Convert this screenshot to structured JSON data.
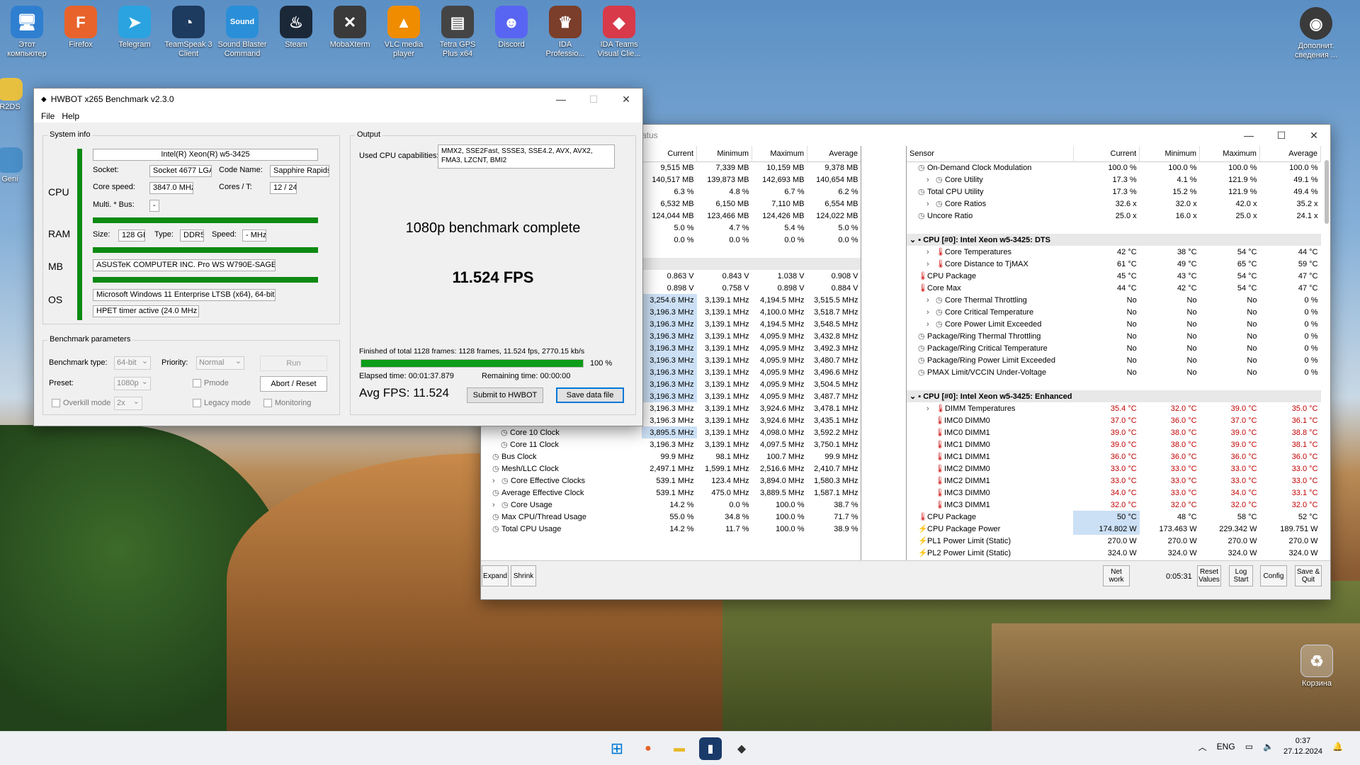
{
  "desktop": {
    "icons": [
      {
        "label": "Этот компьютер",
        "glyph": "🖥",
        "color": "#2f7fd0"
      },
      {
        "label": "Firefox",
        "glyph": "F",
        "color": "#e8632b"
      },
      {
        "label": "Telegram",
        "glyph": "➤",
        "color": "#2aa3e0"
      },
      {
        "label": "TeamSpeak 3 Client",
        "glyph": "◔",
        "color": "#1d3a5f"
      },
      {
        "label": "Sound Blaster Command",
        "glyph": "Sound",
        "color": "#2a8fd8"
      },
      {
        "label": "Steam",
        "glyph": "♨",
        "color": "#1b2838"
      },
      {
        "label": "MobaXterm",
        "glyph": "✕",
        "color": "#3a3a3a"
      },
      {
        "label": "VLC media player",
        "glyph": "▲",
        "color": "#f08c00"
      },
      {
        "label": "Tetra GPS Plus x64",
        "glyph": "▤",
        "color": "#444"
      },
      {
        "label": "Discord",
        "glyph": "☻",
        "color": "#5865f2"
      },
      {
        "label": "IDA Professio...",
        "glyph": "♛",
        "color": "#7a3e2a"
      },
      {
        "label": "IDA Teams Visual Clie...",
        "glyph": "◆",
        "color": "#d83a4a"
      }
    ],
    "right_icon": {
      "label": "Дополнит. сведения ...",
      "glyph": "◉"
    },
    "left_partial": [
      "R2DS",
      "Geni"
    ],
    "recycle": {
      "label": "Корзина"
    }
  },
  "taskbar": {
    "lang": "ENG",
    "time": "0:37",
    "date": "27.12.2024"
  },
  "hwbot": {
    "title": "HWBOT x265 Benchmark v2.3.0",
    "menu": [
      "File",
      "Help"
    ],
    "system_info": {
      "label": "System info",
      "cpu_label": "CPU",
      "cpu_name": "Intel(R) Xeon(R) w5-3425",
      "socket_label": "Socket:",
      "socket": "Socket 4677 LGA",
      "codename_label": "Code Name:",
      "codename": "Sapphire Rapids",
      "corespeed_label": "Core speed:",
      "corespeed": "3847.0 MHz",
      "cores_label": "Cores / T:",
      "cores": "12 / 24",
      "multi_label": "Multi. * Bus:",
      "multi": "-",
      "ram_label": "RAM",
      "size_label": "Size:",
      "size": "128 GB",
      "type_label": "Type:",
      "type": "DDR5",
      "speed_label": "Speed:",
      "speed": "- MHz",
      "mb_label": "MB",
      "mb": "ASUSTeK COMPUTER INC. Pro WS W790E-SAGE SE",
      "os_label": "OS",
      "os": "Microsoft Windows 11  Enterprise LTSB (x64), 64-bit",
      "timer": "HPET timer active (24.0 MHz )"
    },
    "params": {
      "label": "Benchmark parameters",
      "type_label": "Benchmark type:",
      "type": "64-bit",
      "priority_label": "Priority:",
      "priority": "Normal",
      "run": "Run",
      "preset_label": "Preset:",
      "preset": "1080p",
      "pmode": "Pmode",
      "abort": "Abort / Reset",
      "overkill": "Overkill mode",
      "overkill_val": "2x",
      "legacy": "Legacy mode",
      "monitoring": "Monitoring"
    },
    "output": {
      "label": "Output",
      "caps_label": "Used CPU capabilities:",
      "caps": "MMX2, SSE2Fast, SSSE3, SSE4.2, AVX, AVX2, FMA3, LZCNT, BMI2",
      "status": "1080p benchmark complete",
      "fps": "11.524 FPS",
      "finished": "Finished of total 1128 frames: 1128 frames, 11.524 fps,  2770.15 kb/s",
      "progress": 100,
      "progress_text": "100 %",
      "elapsed": "Elapsed time: 00:01:37.879",
      "remaining": "Remaining time: 00:00:00",
      "avg": "Avg FPS: 11.524",
      "submit": "Submit to HWBOT",
      "save": "Save data file"
    }
  },
  "hwinfo": {
    "title_partial": "atus",
    "left_headers": [
      "Current",
      "Minimum",
      "Maximum",
      "Average"
    ],
    "left_rows": [
      {
        "name": "",
        "v": [
          "9,515 MB",
          "7,339 MB",
          "10,159 MB",
          "9,378 MB"
        ]
      },
      {
        "name": "",
        "v": [
          "140,517 MB",
          "139,873 MB",
          "142,693 MB",
          "140,654 MB"
        ]
      },
      {
        "name": "",
        "v": [
          "6.3 %",
          "4.8 %",
          "6.7 %",
          "6.2 %"
        ]
      },
      {
        "name": "",
        "v": [
          "6,532 MB",
          "6,150 MB",
          "7,110 MB",
          "6,554 MB"
        ]
      },
      {
        "name": "",
        "v": [
          "124,044 MB",
          "123,466 MB",
          "124,426 MB",
          "124,022 MB"
        ]
      },
      {
        "name": "",
        "v": [
          "5.0 %",
          "4.7 %",
          "5.4 %",
          "5.0 %"
        ]
      },
      {
        "name": "",
        "v": [
          "0.0 %",
          "0.0 %",
          "0.0 %",
          "0.0 %"
        ]
      },
      {
        "name": "",
        "v": [
          "",
          "",
          "",
          ""
        ]
      },
      {
        "name": "",
        "v": [
          "",
          "",
          "",
          ""
        ],
        "sec": true
      },
      {
        "name": "",
        "v": [
          "0.863 V",
          "0.843 V",
          "1.038 V",
          "0.908 V"
        ]
      },
      {
        "name": "",
        "v": [
          "0.898 V",
          "0.758 V",
          "0.898 V",
          "0.884 V"
        ]
      },
      {
        "name": "",
        "v": [
          "3,254.6 MHz",
          "3,139.1 MHz",
          "4,194.5 MHz",
          "3,515.5 MHz"
        ],
        "hl": true
      },
      {
        "name": "",
        "v": [
          "3,196.3 MHz",
          "3,139.1 MHz",
          "4,100.0 MHz",
          "3,518.7 MHz"
        ],
        "hl": true
      },
      {
        "name": "",
        "v": [
          "3,196.3 MHz",
          "3,139.1 MHz",
          "4,194.5 MHz",
          "3,548.5 MHz"
        ],
        "hl": true
      },
      {
        "name": "",
        "v": [
          "3,196.3 MHz",
          "3,139.1 MHz",
          "4,095.9 MHz",
          "3,432.8 MHz"
        ],
        "hl": true
      },
      {
        "name": "",
        "v": [
          "3,196.3 MHz",
          "3,139.1 MHz",
          "4,095.9 MHz",
          "3,492.3 MHz"
        ],
        "hl": true
      },
      {
        "name": "",
        "v": [
          "3,196.3 MHz",
          "3,139.1 MHz",
          "4,095.9 MHz",
          "3,480.7 MHz"
        ],
        "hl": true
      },
      {
        "name": "",
        "v": [
          "3,196.3 MHz",
          "3,139.1 MHz",
          "4,095.9 MHz",
          "3,496.6 MHz"
        ],
        "hl": true
      },
      {
        "name": "",
        "v": [
          "3,196.3 MHz",
          "3,139.1 MHz",
          "4,095.9 MHz",
          "3,504.5 MHz"
        ],
        "hl": true
      },
      {
        "name": "",
        "v": [
          "3,196.3 MHz",
          "3,139.1 MHz",
          "4,095.9 MHz",
          "3,487.7 MHz"
        ],
        "hl": true
      },
      {
        "name": "",
        "v": [
          "3,196.3 MHz",
          "3,139.1 MHz",
          "3,924.6 MHz",
          "3,478.1 MHz"
        ]
      },
      {
        "name": "Core 9 Clock",
        "ind": 2,
        "v": [
          "3,196.3 MHz",
          "3,139.1 MHz",
          "3,924.6 MHz",
          "3,435.1 MHz"
        ]
      },
      {
        "name": "Core 10 Clock",
        "ind": 2,
        "v": [
          "3,895.5 MHz",
          "3,139.1 MHz",
          "4,098.0 MHz",
          "3,592.2 MHz"
        ],
        "hl": true
      },
      {
        "name": "Core 11 Clock",
        "ind": 2,
        "v": [
          "3,196.3 MHz",
          "3,139.1 MHz",
          "4,097.5 MHz",
          "3,750.1 MHz"
        ]
      },
      {
        "name": "Bus Clock",
        "ind": 1,
        "v": [
          "99.9 MHz",
          "98.1 MHz",
          "100.7 MHz",
          "99.9 MHz"
        ]
      },
      {
        "name": "Mesh/LLC Clock",
        "ind": 1,
        "v": [
          "2,497.1 MHz",
          "1,599.1 MHz",
          "2,516.6 MHz",
          "2,410.7 MHz"
        ]
      },
      {
        "name": "Core Effective Clocks",
        "ind": 1,
        "exp": true,
        "v": [
          "539.1 MHz",
          "123.4 MHz",
          "3,894.0 MHz",
          "1,580.3 MHz"
        ]
      },
      {
        "name": "Average Effective Clock",
        "ind": 1,
        "v": [
          "539.1 MHz",
          "475.0 MHz",
          "3,889.5 MHz",
          "1,587.1 MHz"
        ]
      },
      {
        "name": "Core Usage",
        "ind": 1,
        "exp": true,
        "v": [
          "14.2 %",
          "0.0 %",
          "100.0 %",
          "38.7 %"
        ]
      },
      {
        "name": "Max CPU/Thread Usage",
        "ind": 1,
        "v": [
          "55.0 %",
          "34.8 %",
          "100.0 %",
          "71.7 %"
        ]
      },
      {
        "name": "Total CPU Usage",
        "ind": 1,
        "v": [
          "14.2 %",
          "11.7 %",
          "100.0 %",
          "38.9 %"
        ]
      }
    ],
    "right_headers": [
      "Sensor",
      "Current",
      "Minimum",
      "Maximum",
      "Average"
    ],
    "right_rows": [
      {
        "name": "On-Demand Clock Modulation",
        "ind": 1,
        "v": [
          "100.0 %",
          "100.0 %",
          "100.0 %",
          "100.0 %"
        ]
      },
      {
        "name": "Core Utility",
        "ind": 2,
        "exp": true,
        "v": [
          "17.3 %",
          "4.1 %",
          "121.9 %",
          "49.1 %"
        ]
      },
      {
        "name": "Total CPU Utility",
        "ind": 1,
        "v": [
          "17.3 %",
          "15.2 %",
          "121.9 %",
          "49.4 %"
        ]
      },
      {
        "name": "Core Ratios",
        "ind": 2,
        "exp": true,
        "v": [
          "32.6 x",
          "32.0 x",
          "42.0 x",
          "35.2 x"
        ]
      },
      {
        "name": "Uncore Ratio",
        "ind": 1,
        "v": [
          "25.0 x",
          "16.0 x",
          "25.0 x",
          "24.1 x"
        ]
      },
      {
        "name": "",
        "v": [
          "",
          "",
          "",
          ""
        ],
        "blank": true
      },
      {
        "name": "CPU [#0]: Intel Xeon w5-3425: DTS",
        "sec": true,
        "v": [
          "",
          "",
          "",
          ""
        ]
      },
      {
        "name": "Core Temperatures",
        "ind": 2,
        "exp": true,
        "t": true,
        "v": [
          "42 °C",
          "38 °C",
          "54 °C",
          "44 °C"
        ]
      },
      {
        "name": "Core Distance to TjMAX",
        "ind": 2,
        "exp": true,
        "t": true,
        "v": [
          "61 °C",
          "49 °C",
          "65 °C",
          "59 °C"
        ]
      },
      {
        "name": "CPU Package",
        "ind": 1,
        "t": true,
        "v": [
          "45 °C",
          "43 °C",
          "54 °C",
          "47 °C"
        ]
      },
      {
        "name": "Core Max",
        "ind": 1,
        "t": true,
        "v": [
          "44 °C",
          "42 °C",
          "54 °C",
          "47 °C"
        ]
      },
      {
        "name": "Core Thermal Throttling",
        "ind": 2,
        "exp": true,
        "v": [
          "No",
          "No",
          "No",
          "0 %"
        ]
      },
      {
        "name": "Core Critical Temperature",
        "ind": 2,
        "exp": true,
        "v": [
          "No",
          "No",
          "No",
          "0 %"
        ]
      },
      {
        "name": "Core Power Limit Exceeded",
        "ind": 2,
        "exp": true,
        "v": [
          "No",
          "No",
          "No",
          "0 %"
        ]
      },
      {
        "name": "Package/Ring Thermal Throttling",
        "ind": 1,
        "v": [
          "No",
          "No",
          "No",
          "0 %"
        ]
      },
      {
        "name": "Package/Ring Critical Temperature",
        "ind": 1,
        "v": [
          "No",
          "No",
          "No",
          "0 %"
        ]
      },
      {
        "name": "Package/Ring Power Limit Exceeded",
        "ind": 1,
        "v": [
          "No",
          "No",
          "No",
          "0 %"
        ]
      },
      {
        "name": "PMAX Limit/VCCIN Under-Voltage",
        "ind": 1,
        "v": [
          "No",
          "No",
          "No",
          "0 %"
        ]
      },
      {
        "name": "",
        "v": [
          "",
          "",
          "",
          ""
        ],
        "blank": true
      },
      {
        "name": "CPU [#0]: Intel Xeon w5-3425: Enhanced",
        "sec": true,
        "v": [
          "",
          "",
          "",
          ""
        ]
      },
      {
        "name": "DIMM Temperatures",
        "ind": 2,
        "exp": true,
        "t": true,
        "red": true,
        "v": [
          "35.4 °C",
          "32.0 °C",
          "39.0 °C",
          "35.0 °C"
        ]
      },
      {
        "name": "IMC0 DIMM0",
        "ind": 3,
        "t": true,
        "red": true,
        "v": [
          "37.0 °C",
          "36.0 °C",
          "37.0 °C",
          "36.1 °C"
        ]
      },
      {
        "name": "IMC0 DIMM1",
        "ind": 3,
        "t": true,
        "red": true,
        "v": [
          "39.0 °C",
          "38.0 °C",
          "39.0 °C",
          "38.8 °C"
        ]
      },
      {
        "name": "IMC1 DIMM0",
        "ind": 3,
        "t": true,
        "red": true,
        "v": [
          "39.0 °C",
          "38.0 °C",
          "39.0 °C",
          "38.1 °C"
        ]
      },
      {
        "name": "IMC1 DIMM1",
        "ind": 3,
        "t": true,
        "red": true,
        "v": [
          "36.0 °C",
          "36.0 °C",
          "36.0 °C",
          "36.0 °C"
        ]
      },
      {
        "name": "IMC2 DIMM0",
        "ind": 3,
        "t": true,
        "red": true,
        "v": [
          "33.0 °C",
          "33.0 °C",
          "33.0 °C",
          "33.0 °C"
        ]
      },
      {
        "name": "IMC2 DIMM1",
        "ind": 3,
        "t": true,
        "red": true,
        "v": [
          "33.0 °C",
          "33.0 °C",
          "33.0 °C",
          "33.0 °C"
        ]
      },
      {
        "name": "IMC3 DIMM0",
        "ind": 3,
        "t": true,
        "red": true,
        "v": [
          "34.0 °C",
          "33.0 °C",
          "34.0 °C",
          "33.1 °C"
        ]
      },
      {
        "name": "IMC3 DIMM1",
        "ind": 3,
        "t": true,
        "red": true,
        "v": [
          "32.0 °C",
          "32.0 °C",
          "32.0 °C",
          "32.0 °C"
        ]
      },
      {
        "name": "CPU Package",
        "ind": 1,
        "t": true,
        "hl": true,
        "v": [
          "50 °C",
          "48 °C",
          "58 °C",
          "52 °C"
        ]
      },
      {
        "name": "CPU Package Power",
        "ind": 1,
        "p": true,
        "hl": true,
        "v": [
          "174.802 W",
          "173.463 W",
          "229.342 W",
          "189.751 W"
        ]
      },
      {
        "name": "PL1 Power Limit (Static)",
        "ind": 1,
        "p": true,
        "v": [
          "270.0 W",
          "270.0 W",
          "270.0 W",
          "270.0 W"
        ]
      },
      {
        "name": "PL2 Power Limit (Static)",
        "ind": 1,
        "p": true,
        "v": [
          "324.0 W",
          "324.0 W",
          "324.0 W",
          "324.0 W"
        ]
      }
    ],
    "bottom": {
      "expand": "Expand",
      "shrink": "Shrink",
      "network": "Net work",
      "uptime": "0:05:31",
      "reset": "Reset Values",
      "log": "Log Start",
      "config": "Config",
      "save_quit": "Save & Quit"
    }
  }
}
